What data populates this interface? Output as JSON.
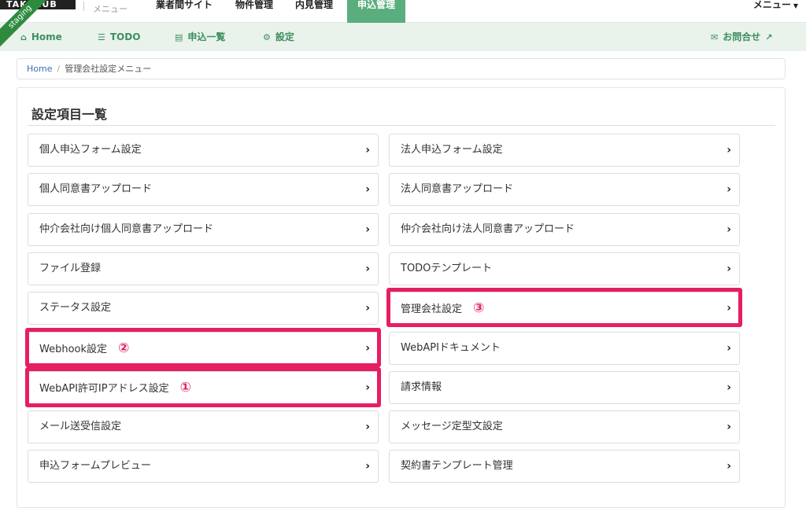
{
  "topnav": {
    "logo": "TAKEHUB",
    "menu_label": "メニュー",
    "items": [
      "業者間サイト",
      "物件管理",
      "内見管理"
    ],
    "active_item": "申込管理",
    "right_menu": "メニュー",
    "ribbon": "staging"
  },
  "subnav": {
    "home": "Home",
    "todo": "TODO",
    "list": "申込一覧",
    "settings": "設定",
    "contact": "お問合せ"
  },
  "breadcrumb": {
    "home": "Home",
    "current": "管理会社設定メニュー"
  },
  "panel": {
    "title": "設定項目一覧",
    "left": [
      "個人申込フォーム設定",
      "個人同意書アップロード",
      "仲介会社向け個人同意書アップロード",
      "ファイル登録",
      "ステータス設定",
      "Webhook設定",
      "WebAPI許可IPアドレス設定",
      "メール送受信設定",
      "申込フォームプレビュー"
    ],
    "right": [
      "法人申込フォーム設定",
      "法人同意書アップロード",
      "仲介会社向け法人同意書アップロード",
      "TODOテンプレート",
      "管理会社設定",
      "WebAPIドキュメント",
      "請求情報",
      "メッセージ定型文設定",
      "契約書テンプレート管理"
    ],
    "markers": {
      "webapi_ip": "①",
      "webhook": "②",
      "company": "③"
    }
  },
  "colors": {
    "accent": "#5aad7d",
    "subnav_bg": "#e9f3ec",
    "highlight": "#e61e63"
  }
}
